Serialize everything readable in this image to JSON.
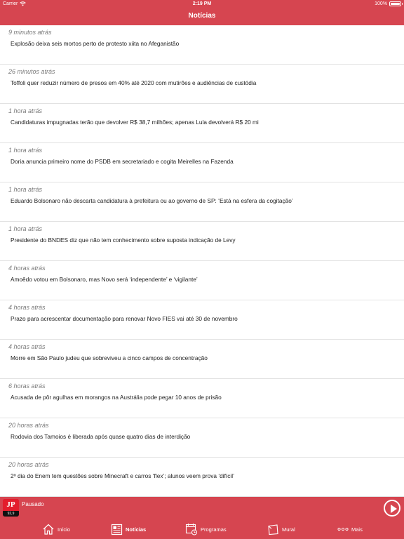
{
  "status_bar": {
    "carrier": "Carrier",
    "time": "2:19 PM",
    "battery": "100%"
  },
  "nav": {
    "title": "Notícias"
  },
  "news": [
    {
      "time": "9 minutos atrás",
      "headline": "Explosão deixa seis mortos perto de protesto xiita no Afeganistão"
    },
    {
      "time": "26 minutos atrás",
      "headline": "Toffoli quer reduzir número de presos em 40% até 2020 com mutirões e audiências de custódia"
    },
    {
      "time": "1 hora atrás",
      "headline": "Candidaturas impugnadas terão que devolver R$ 38,7 milhões; apenas Lula devolverá R$ 20 mi"
    },
    {
      "time": "1 hora atrás",
      "headline": "Doria anuncia primeiro nome do PSDB em secretariado e cogita Meirelles na Fazenda"
    },
    {
      "time": "1 hora atrás",
      "headline": "Eduardo Bolsonaro não descarta candidatura à prefeitura ou ao governo de SP: ‘Está na esfera da cogitação’"
    },
    {
      "time": "1 hora atrás",
      "headline": "Presidente do BNDES diz que não tem conhecimento sobre suposta indicação de Levy"
    },
    {
      "time": "4 horas atrás",
      "headline": "Amoêdo votou em Bolsonaro, mas Novo será ‘independente’ e ‘vigilante’"
    },
    {
      "time": "4 horas atrás",
      "headline": "Prazo para acrescentar documentação para renovar Novo FIES vai até 30 de novembro"
    },
    {
      "time": "4 horas atrás",
      "headline": "Morre em São Paulo judeu que sobreviveu a cinco campos de concentração"
    },
    {
      "time": "6 horas atrás",
      "headline": "Acusada de pôr agulhas em morangos na Austrália pode pegar 10 anos de prisão"
    },
    {
      "time": "20 horas atrás",
      "headline": "Rodovia dos Tamoios é liberada após quase quatro dias de interdição"
    },
    {
      "time": "20 horas atrás",
      "headline": "2º dia do Enem tem questões sobre Minecraft e carros ‘flex’; alunos veem prova ‘difícil’"
    }
  ],
  "player": {
    "status": "Pausado",
    "logo_top": "JP",
    "logo_bottom": "92,9",
    "play_icon": "play-icon"
  },
  "tabs": [
    {
      "label": "Início",
      "icon": "home-icon"
    },
    {
      "label": "Notícias",
      "icon": "news-icon",
      "active": true
    },
    {
      "label": "Programas",
      "icon": "calendar-icon"
    },
    {
      "label": "Mural",
      "icon": "mural-icon"
    },
    {
      "label": "Mais",
      "icon": "more-icon"
    }
  ],
  "colors": {
    "brand": "#d64550",
    "divider": "#e2e2e2",
    "time_text": "#7a7a7a",
    "headline_text": "#222222"
  }
}
